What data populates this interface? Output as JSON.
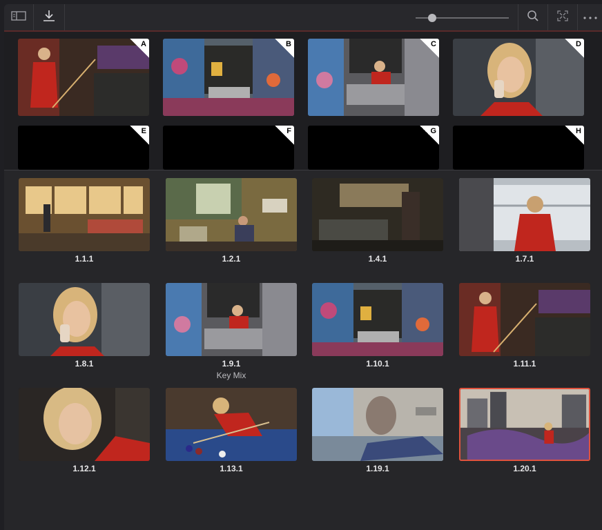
{
  "toolbar": {
    "sidebar_toggle": "sidebar-icon",
    "import": "download-icon",
    "zoom_level": 0.15,
    "search": "search-icon",
    "fullscreen": "fullscreen-icon",
    "more": "ellipsis-icon"
  },
  "stills": [
    {
      "label": "A",
      "scene": "woman-cue-red"
    },
    {
      "label": "B",
      "scene": "graffiti-building"
    },
    {
      "label": "C",
      "scene": "graffiti-balcony"
    },
    {
      "label": "D",
      "scene": "closeup-phone"
    },
    {
      "label": "E",
      "scene": "blank"
    },
    {
      "label": "F",
      "scene": "blank"
    },
    {
      "label": "G",
      "scene": "blank"
    },
    {
      "label": "H",
      "scene": "blank"
    }
  ],
  "clips": [
    {
      "number": "1.1.1",
      "label": "",
      "scene": "loft-warm"
    },
    {
      "number": "1.2.1",
      "label": "",
      "scene": "loft-desk"
    },
    {
      "number": "1.4.1",
      "label": "",
      "scene": "loft-dark"
    },
    {
      "number": "1.7.1",
      "label": "",
      "scene": "woman-window"
    },
    {
      "number": "1.8.1",
      "label": "",
      "scene": "closeup-phone"
    },
    {
      "number": "1.9.1",
      "label": "Key Mix",
      "scene": "graffiti-balcony"
    },
    {
      "number": "1.10.1",
      "label": "",
      "scene": "graffiti-building"
    },
    {
      "number": "1.11.1",
      "label": "",
      "scene": "woman-cue-red"
    },
    {
      "number": "1.12.1",
      "label": "",
      "scene": "closeup-face"
    },
    {
      "number": "1.13.1",
      "label": "",
      "scene": "pool-table"
    },
    {
      "number": "1.19.1",
      "label": "",
      "scene": "mural-sky"
    },
    {
      "number": "1.20.1",
      "label": "",
      "scene": "rooftop-city",
      "selected": true
    }
  ],
  "colors": {
    "accent": "#e0533e",
    "panel": "#262629"
  }
}
